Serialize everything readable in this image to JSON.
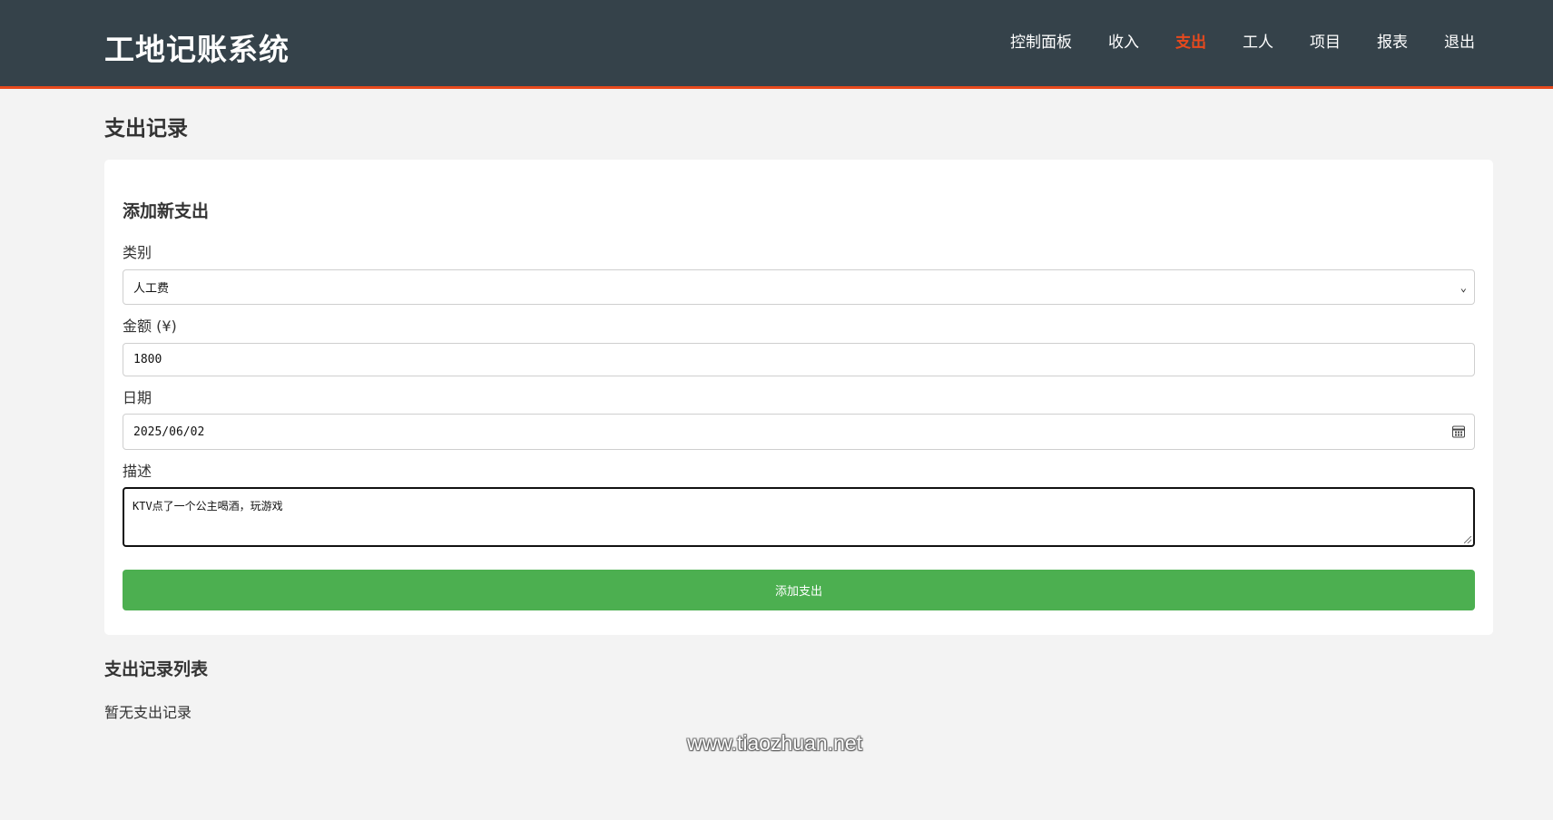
{
  "header": {
    "logo": "工地记账系统",
    "nav": [
      {
        "label": "控制面板",
        "active": false
      },
      {
        "label": "收入",
        "active": false
      },
      {
        "label": "支出",
        "active": true
      },
      {
        "label": "工人",
        "active": false
      },
      {
        "label": "项目",
        "active": false
      },
      {
        "label": "报表",
        "active": false
      },
      {
        "label": "退出",
        "active": false
      }
    ]
  },
  "page": {
    "title": "支出记录"
  },
  "form": {
    "title": "添加新支出",
    "category": {
      "label": "类别",
      "value": "人工费"
    },
    "amount": {
      "label": "金额 (¥)",
      "value": "1800"
    },
    "date": {
      "label": "日期",
      "value": "2025/06/02"
    },
    "description": {
      "label": "描述",
      "value": "KTV点了一个公主喝酒，玩游戏"
    },
    "submit_label": "添加支出"
  },
  "list": {
    "title": "支出记录列表",
    "empty_text": "暂无支出记录"
  },
  "watermark": "www.tiaozhuan.net",
  "colors": {
    "header_bg": "#35424a",
    "accent": "#e8491d",
    "button": "#4caf50",
    "page_bg": "#f3f3f3"
  }
}
